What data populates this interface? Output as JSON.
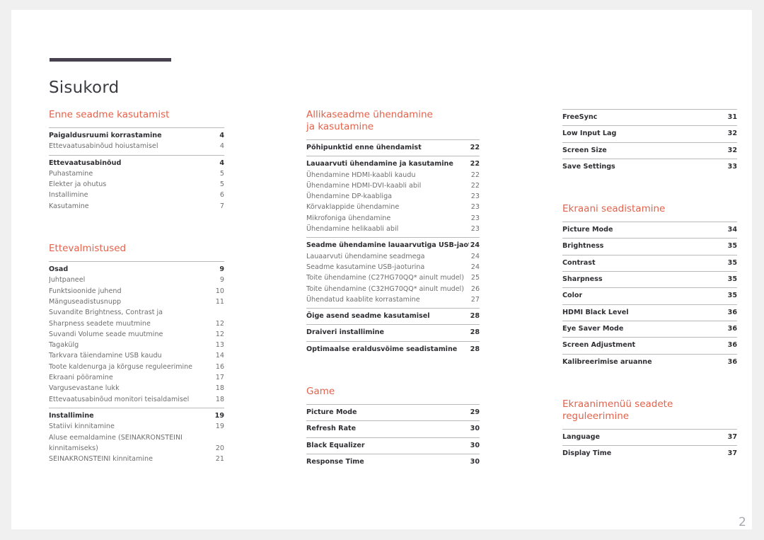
{
  "page": {
    "title": "Sisukord",
    "number": "2"
  },
  "columns": [
    {
      "name": "column-1",
      "sections": [
        {
          "heading": "Enne seadme kasutamist",
          "groups": [
            {
              "entries": [
                {
                  "label": "Paigaldusruumi korrastamine",
                  "page": "4",
                  "primary": true
                },
                {
                  "label": "Ettevaatusabinõud hoiustamisel",
                  "page": "4",
                  "primary": false
                }
              ]
            },
            {
              "entries": [
                {
                  "label": "Ettevaatusabinõud",
                  "page": "4",
                  "primary": true
                },
                {
                  "label": "Puhastamine",
                  "page": "5",
                  "primary": false
                },
                {
                  "label": "Elekter ja ohutus",
                  "page": "5",
                  "primary": false
                },
                {
                  "label": "Installimine",
                  "page": "6",
                  "primary": false
                },
                {
                  "label": "Kasutamine",
                  "page": "7",
                  "primary": false
                }
              ]
            }
          ]
        },
        {
          "heading": "Ettevalmistused",
          "groups": [
            {
              "entries": [
                {
                  "label": "Osad",
                  "page": "9",
                  "primary": true
                },
                {
                  "label": "Juhtpaneel",
                  "page": "9",
                  "primary": false
                },
                {
                  "label": "Funktsioonide juhend",
                  "page": "10",
                  "primary": false
                },
                {
                  "label": "Mänguseadistusnupp",
                  "page": "11",
                  "primary": false
                },
                {
                  "label": "Suvandite Brightness, Contrast ja",
                  "label2": "Sharpness seadete muutmine",
                  "page": "12",
                  "primary": false,
                  "twoline": true
                },
                {
                  "label": "Suvandi Volume seade muutmine",
                  "page": "12",
                  "primary": false
                },
                {
                  "label": "Tagakülg",
                  "page": "13",
                  "primary": false
                },
                {
                  "label": "Tarkvara täiendamine USB kaudu",
                  "page": "14",
                  "primary": false
                },
                {
                  "label": "Toote kaldenurga ja kõrguse reguleerimine",
                  "page": "16",
                  "primary": false,
                  "squeeze": true
                },
                {
                  "label": "Ekraani pööramine",
                  "page": "17",
                  "primary": false
                },
                {
                  "label": "Vargusevastane lukk",
                  "page": "18",
                  "primary": false
                },
                {
                  "label": "Ettevaatusabinõud monitori teisaldamisel",
                  "page": "18",
                  "primary": false,
                  "squeeze": true
                }
              ]
            },
            {
              "entries": [
                {
                  "label": "Installimine",
                  "page": "19",
                  "primary": true
                },
                {
                  "label": "Statiivi kinnitamine",
                  "page": "19",
                  "primary": false
                },
                {
                  "label": "Aluse eemaldamine (SEINAKRONSTEINI",
                  "label2": "kinnitamiseks)",
                  "page": "20",
                  "primary": false,
                  "twoline": true,
                  "noindent": true
                },
                {
                  "label": "SEINAKRONSTEINI kinnitamine",
                  "page": "21",
                  "primary": false
                }
              ]
            }
          ]
        }
      ]
    },
    {
      "name": "column-2",
      "sections": [
        {
          "heading": "Allikaseadme ühendamine\nja kasutamine",
          "groups": [
            {
              "entries": [
                {
                  "label": "Põhipunktid enne ühendamist",
                  "page": "22",
                  "primary": true
                }
              ]
            },
            {
              "entries": [
                {
                  "label": "Lauaarvuti ühendamine ja kasutamine",
                  "page": "22",
                  "primary": true
                },
                {
                  "label": "Ühendamine HDMI-kaabli kaudu",
                  "page": "22",
                  "primary": false
                },
                {
                  "label": "Ühendamine HDMI-DVI-kaabli abil",
                  "page": "22",
                  "primary": false
                },
                {
                  "label": "Ühendamine DP-kaabliga",
                  "page": "23",
                  "primary": false
                },
                {
                  "label": "Kõrvaklappide ühendamine",
                  "page": "23",
                  "primary": false
                },
                {
                  "label": "Mikrofoniga ühendamine",
                  "page": "23",
                  "primary": false
                },
                {
                  "label": "Ühendamine helikaabli abil",
                  "page": "23",
                  "primary": false
                }
              ]
            },
            {
              "entries": [
                {
                  "label": "Seadme ühendamine lauaarvutiga USB-jaoturina",
                  "page": "24",
                  "primary": true,
                  "squeeze": true
                },
                {
                  "label": "Lauaarvuti ühendamine seadmega",
                  "page": "24",
                  "primary": false
                },
                {
                  "label": "Seadme kasutamine USB-jaoturina",
                  "page": "24",
                  "primary": false
                },
                {
                  "label": "Toite ühendamine (C27HG70QQ* ainult mudel)",
                  "page": "25",
                  "primary": false,
                  "squeeze": true
                },
                {
                  "label": "Toite ühendamine (C32HG70QQ* ainult mudel)",
                  "page": "26",
                  "primary": false,
                  "squeeze": true
                },
                {
                  "label": "Ühendatud kaablite korrastamine",
                  "page": "27",
                  "primary": false
                }
              ]
            },
            {
              "entries": [
                {
                  "label": "Õige asend seadme kasutamisel",
                  "page": "28",
                  "primary": true
                }
              ]
            },
            {
              "entries": [
                {
                  "label": "Draiveri installimine",
                  "page": "28",
                  "primary": true
                }
              ]
            },
            {
              "entries": [
                {
                  "label": "Optimaalse eraldusvõime seadistamine",
                  "page": "28",
                  "primary": true
                }
              ]
            }
          ]
        },
        {
          "heading": "Game",
          "groups": [
            {
              "entries": [
                {
                  "label": "Picture Mode",
                  "page": "29",
                  "primary": true
                }
              ]
            },
            {
              "entries": [
                {
                  "label": "Refresh Rate",
                  "page": "30",
                  "primary": true
                }
              ]
            },
            {
              "entries": [
                {
                  "label": "Black Equalizer",
                  "page": "30",
                  "primary": true
                }
              ]
            },
            {
              "entries": [
                {
                  "label": "Response Time",
                  "page": "30",
                  "primary": true
                }
              ]
            }
          ]
        }
      ]
    },
    {
      "name": "column-3",
      "sections": [
        {
          "heading": "",
          "groups": [
            {
              "entries": [
                {
                  "label": "FreeSync",
                  "page": "31",
                  "primary": true
                }
              ]
            },
            {
              "entries": [
                {
                  "label": "Low Input Lag",
                  "page": "32",
                  "primary": true
                }
              ]
            },
            {
              "entries": [
                {
                  "label": "Screen Size",
                  "page": "32",
                  "primary": true
                }
              ]
            },
            {
              "entries": [
                {
                  "label": "Save Settings",
                  "page": "33",
                  "primary": true
                }
              ]
            }
          ]
        },
        {
          "heading": "Ekraani seadistamine",
          "groups": [
            {
              "entries": [
                {
                  "label": "Picture Mode",
                  "page": "34",
                  "primary": true
                }
              ]
            },
            {
              "entries": [
                {
                  "label": "Brightness",
                  "page": "35",
                  "primary": true
                }
              ]
            },
            {
              "entries": [
                {
                  "label": "Contrast",
                  "page": "35",
                  "primary": true
                }
              ]
            },
            {
              "entries": [
                {
                  "label": "Sharpness",
                  "page": "35",
                  "primary": true
                }
              ]
            },
            {
              "entries": [
                {
                  "label": "Color",
                  "page": "35",
                  "primary": true
                }
              ]
            },
            {
              "entries": [
                {
                  "label": "HDMI Black Level",
                  "page": "36",
                  "primary": true
                }
              ]
            },
            {
              "entries": [
                {
                  "label": "Eye Saver Mode",
                  "page": "36",
                  "primary": true
                }
              ]
            },
            {
              "entries": [
                {
                  "label": "Screen Adjustment",
                  "page": "36",
                  "primary": true
                }
              ]
            },
            {
              "entries": [
                {
                  "label": "Kalibreerimise aruanne",
                  "page": "36",
                  "primary": true
                }
              ]
            }
          ]
        },
        {
          "heading": "Ekraanimenüü seadete reguleerimine",
          "groups": [
            {
              "entries": [
                {
                  "label": "Language",
                  "page": "37",
                  "primary": true
                }
              ]
            },
            {
              "entries": [
                {
                  "label": "Display Time",
                  "page": "37",
                  "primary": true
                }
              ]
            }
          ]
        }
      ]
    }
  ],
  "colors": {
    "accent": "#e4614a",
    "title_rule": "#474150",
    "rule": "#b9b9b9",
    "primary_text": "#2f2f33",
    "secondary_text": "#6e6e6e",
    "page_number": "#a8a8ae",
    "page_background": "#ffffff",
    "canvas_background": "#f0f0f0"
  }
}
